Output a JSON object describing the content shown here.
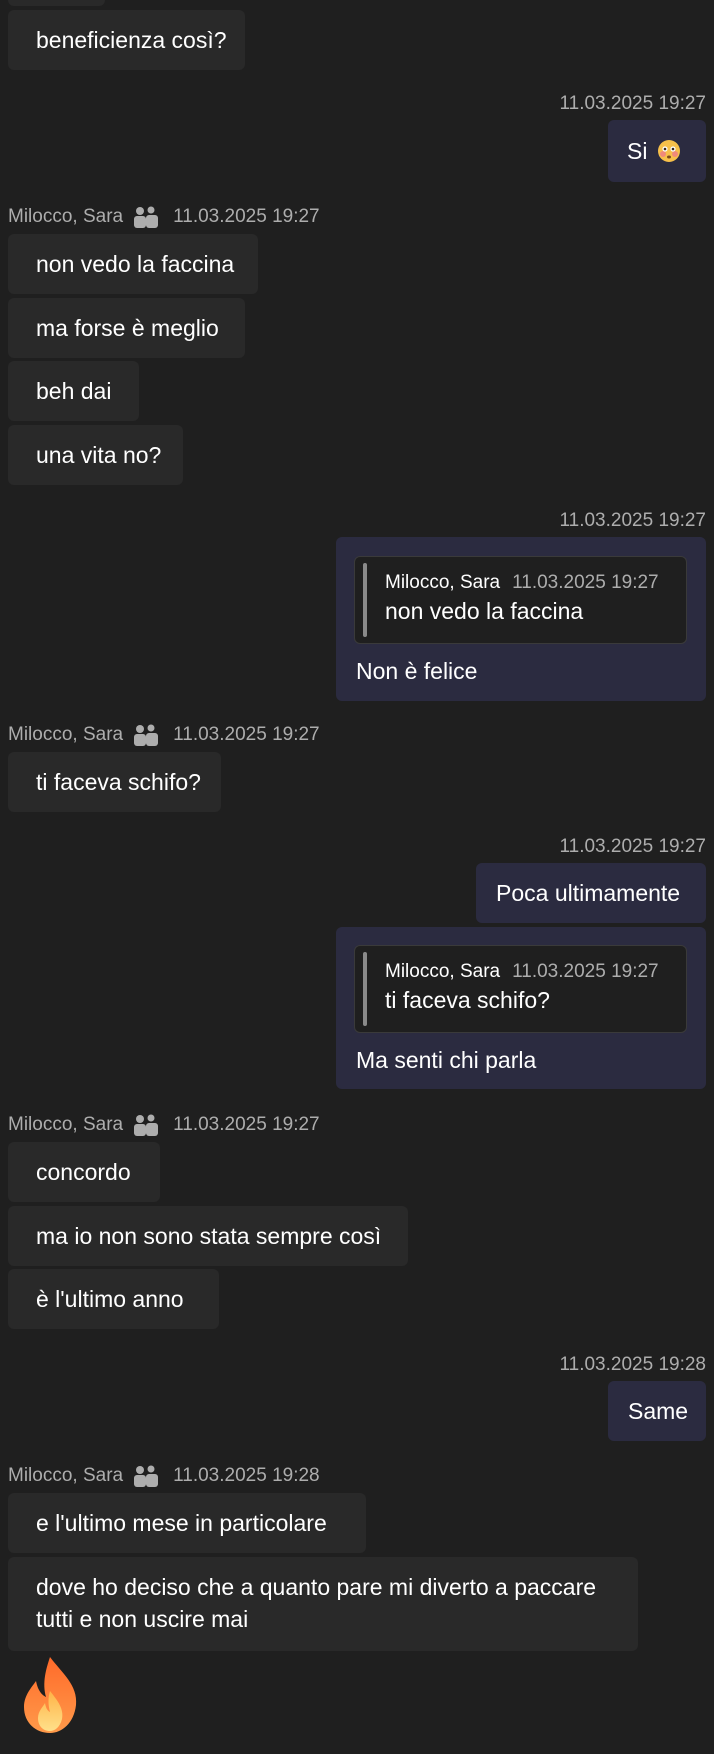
{
  "chat": {
    "m0": "beneficienza così?",
    "t1": "11.03.2025 19:27",
    "m1": "Si",
    "g2": {
      "name": "Milocco, Sara",
      "time": "11.03.2025 19:27"
    },
    "m2a": "non vedo la faccina",
    "m2b": "ma forse è meglio",
    "m2c": "beh dai",
    "m2d": "una vita no?",
    "t3": "11.03.2025 19:27",
    "q3": {
      "name": "Milocco, Sara",
      "time": "11.03.2025 19:27",
      "text": "non vedo la faccina"
    },
    "m3": "Non è felice",
    "g4": {
      "name": "Milocco, Sara",
      "time": "11.03.2025 19:27"
    },
    "m4": "ti faceva schifo?",
    "t5": "11.03.2025 19:27",
    "m5": "Poca ultimamente",
    "q5": {
      "name": "Milocco, Sara",
      "time": "11.03.2025 19:27",
      "text": "ti faceva schifo?"
    },
    "m5b": "Ma senti chi parla",
    "g6": {
      "name": "Milocco, Sara",
      "time": "11.03.2025 19:27"
    },
    "m6a": "concordo",
    "m6b": "ma io non sono stata sempre così",
    "m6c": "è l'ultimo anno",
    "t7": "11.03.2025 19:28",
    "m7": "Same",
    "g8": {
      "name": "Milocco, Sara",
      "time": "11.03.2025 19:28"
    },
    "m8a": "e l'ultimo mese in particolare",
    "m8b": "dove ho deciso che a quanto pare mi diverto a paccare tutti e non uscire mai"
  },
  "icons": {
    "sender": "people-icon",
    "emoji_flushed": "flushed-face-icon",
    "fire": "fire-icon"
  },
  "colors": {
    "background": "#1f1f1f",
    "incoming_bubble": "#292929",
    "outgoing_bubble": "#2b2b40",
    "meta_text": "#adadad"
  }
}
